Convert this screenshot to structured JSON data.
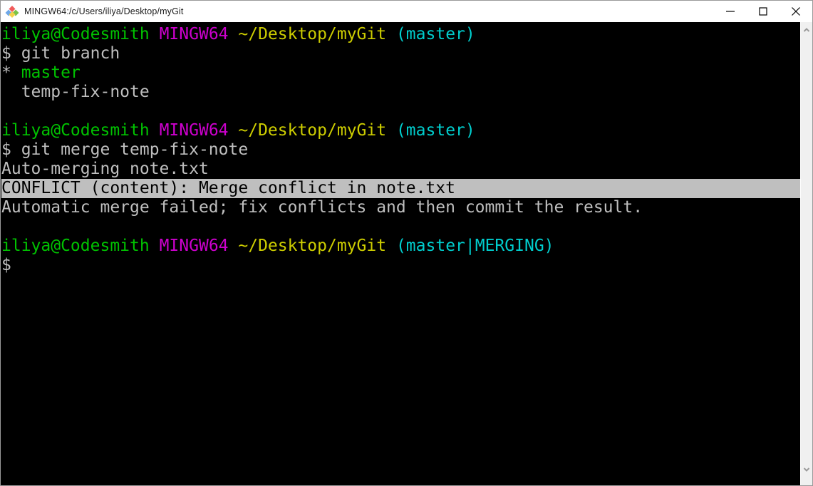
{
  "window": {
    "title": "MINGW64:/c/Users/iliya/Desktop/myGit",
    "icon": "git-bash-diamond-icon",
    "controls": {
      "minimize": "minimize-icon",
      "maximize": "maximize-icon",
      "close": "close-icon"
    }
  },
  "colors": {
    "background": "#000000",
    "foreground": "#bfbfbf",
    "green": "#00c200",
    "magenta": "#cd00cd",
    "yellow": "#cdcd00",
    "cyan": "#00cdcd",
    "highlight_bg": "#bfbfbf",
    "highlight_fg": "#000000",
    "titlebar_bg": "#ffffff",
    "scrollbar_bg": "#f0f0f0"
  },
  "terminal": {
    "prompt_user_host": "iliya@Codesmith",
    "prompt_shell": "MINGW64",
    "prompt_path": "~/Desktop/myGit",
    "prompt_branch_master": "(master)",
    "prompt_branch_merging": "(master|MERGING)",
    "prompt_symbol": "$",
    "commands": {
      "git_branch": " git branch",
      "git_merge": " git merge temp-fix-note"
    },
    "branch_list": {
      "current_marker": "* ",
      "current_branch": "master",
      "other_branch": "  temp-fix-note"
    },
    "output": {
      "auto_merging": "Auto-merging note.txt",
      "conflict": "CONFLICT (content): Merge conflict in note.txt",
      "failed": "Automatic merge failed; fix conflicts and then commit the result."
    }
  },
  "scrollbar": {
    "up_arrow": "chevron-up-icon",
    "down_arrow": "chevron-down-icon"
  }
}
